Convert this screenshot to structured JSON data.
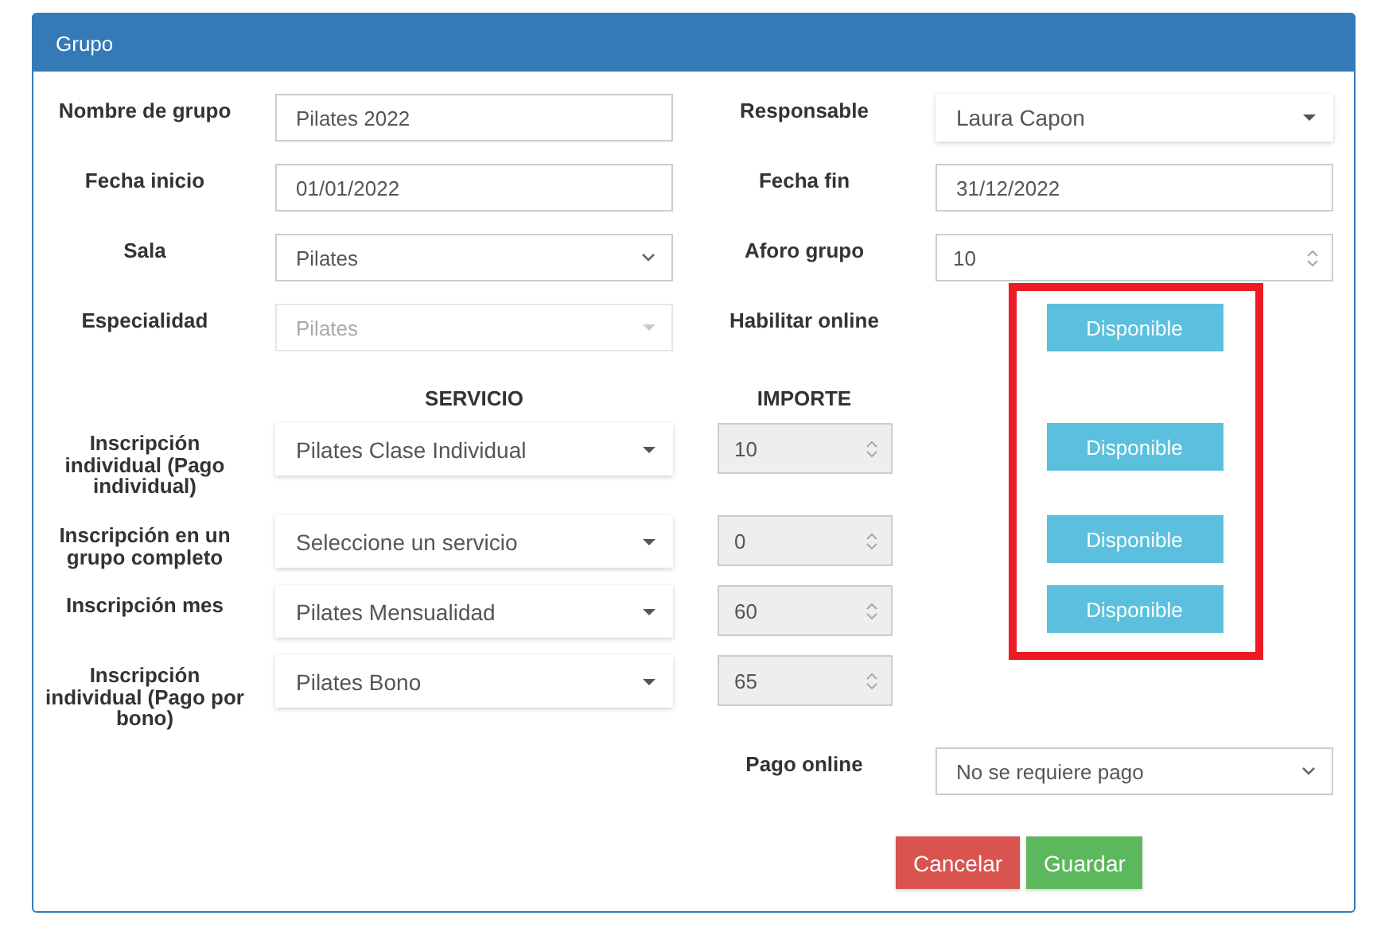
{
  "panel": {
    "title": "Grupo"
  },
  "rows": [
    {
      "left": {
        "label": "Nombre de grupo",
        "kind": "text",
        "value": "Pilates 2022"
      },
      "right": {
        "label": "Responsable",
        "kind": "dropdown",
        "value": "Laura Capon"
      }
    },
    {
      "left": {
        "label": "Fecha inicio",
        "kind": "text",
        "value": "01/01/2022"
      },
      "right": {
        "label": "Fecha fin",
        "kind": "text",
        "value": "31/12/2022"
      }
    },
    {
      "left": {
        "label": "Sala",
        "kind": "select",
        "value": "Pilates"
      },
      "right": {
        "label": "Aforo grupo",
        "kind": "number",
        "value": "10"
      }
    },
    {
      "left": {
        "label": "Especialidad",
        "kind": "dropdown",
        "value": "Pilates",
        "disabled": true
      },
      "right": {
        "label": "Habilitar online",
        "kind": "toggle",
        "value": "Disponible",
        "on": true
      }
    }
  ],
  "columns": {
    "service": "SERVICIO",
    "amount": "IMPORTE"
  },
  "services": [
    {
      "label": "Inscripción individual (Pago individual)",
      "service": "Pilates Clase Individual",
      "amount": "10",
      "online": {
        "text": "Disponible",
        "on": true
      }
    },
    {
      "label": "Inscripción en un grupo completo",
      "service": "Seleccione un servicio",
      "amount": "0",
      "online": {
        "text": "Disponible",
        "on": true
      }
    },
    {
      "label": "Inscripción mes",
      "service": "Pilates Mensualidad",
      "amount": "60",
      "online": {
        "text": "Disponible",
        "on": true
      }
    },
    {
      "label": "Inscripción individual (Pago por bono)",
      "service": "Pilates Bono",
      "amount": "65"
    }
  ],
  "payment": {
    "label": "Pago online",
    "value": "No se requiere pago"
  },
  "buttons": [
    {
      "label": "Cancelar",
      "kind": "danger"
    },
    {
      "label": "Guardar",
      "kind": "success"
    }
  ],
  "highlight": {
    "kind": "frame"
  }
}
